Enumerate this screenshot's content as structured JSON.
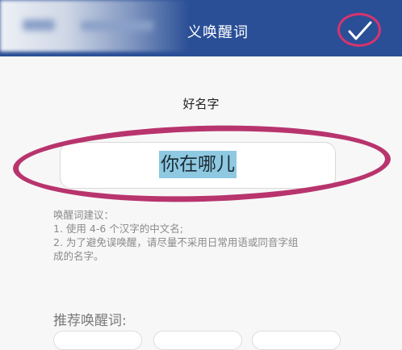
{
  "header": {
    "title": "义唤醒词",
    "confirm_icon": "checkmark-icon",
    "background_color": "#2a4f96"
  },
  "form": {
    "label": "好名字",
    "value": "你在哪儿"
  },
  "hint": {
    "title": "唤醒词建议：",
    "lines": [
      "1. 使用 4-6 个汉字的中文名;",
      "2. 为了避免误唤醒，请尽量不采用日常用语或同音字组",
      "成的名字。"
    ]
  },
  "recommend": {
    "title": "推荐唤醒词:"
  },
  "annotation": {
    "color": "#b8346d"
  }
}
